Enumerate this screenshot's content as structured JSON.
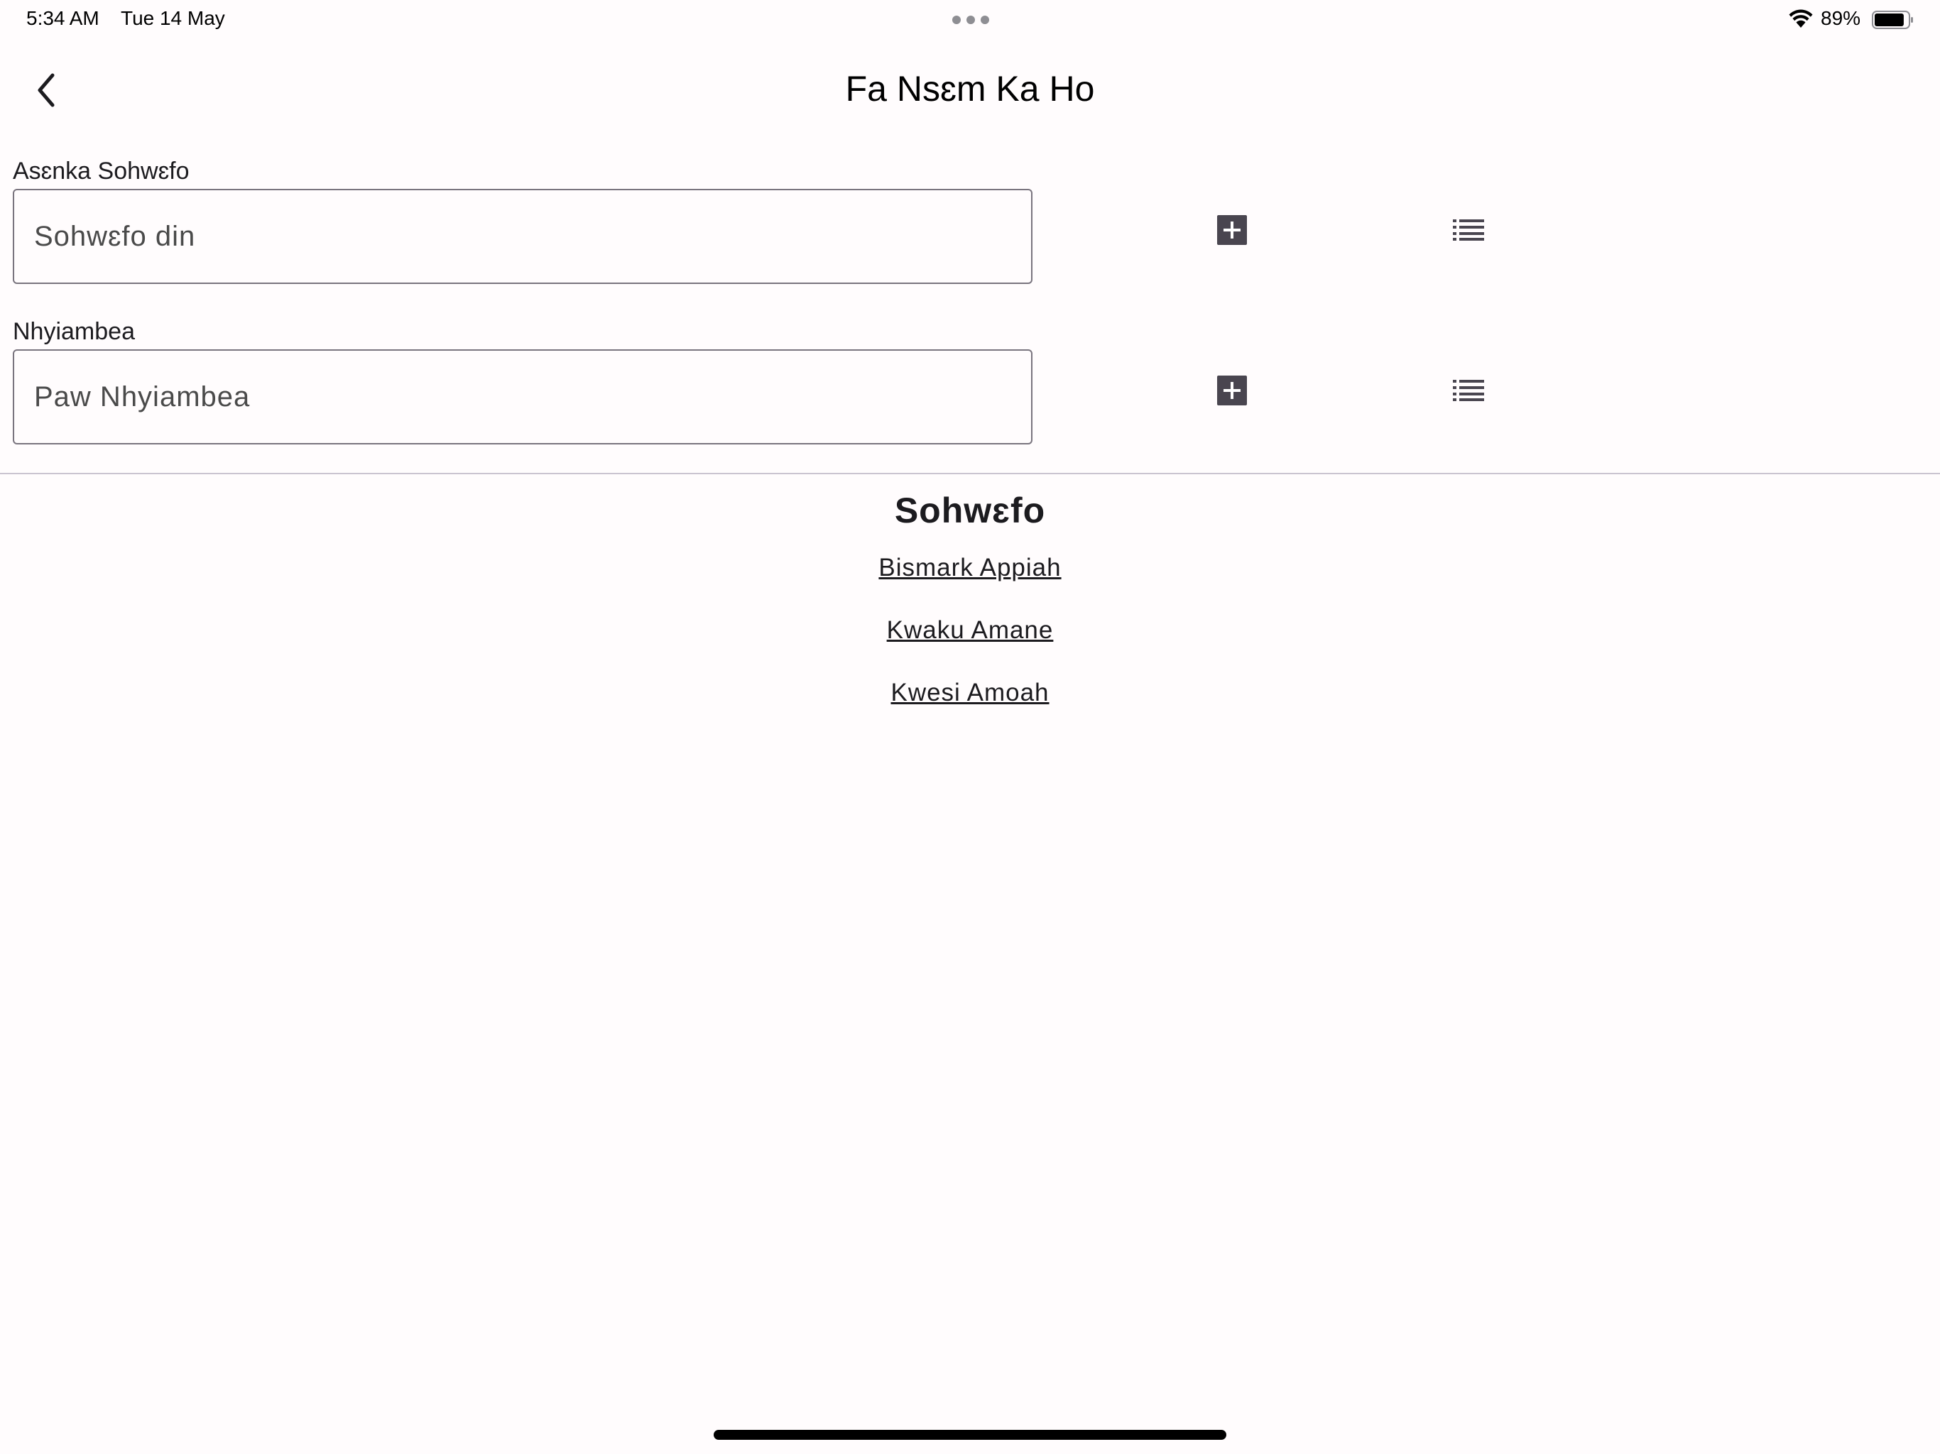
{
  "status_bar": {
    "time": "5:34 AM",
    "date": "Tue 14 May",
    "battery_percent": "89%",
    "battery_level": 0.89
  },
  "header": {
    "title": "Fa Nsɛm Ka Ho",
    "back_icon": "chevron-left-icon"
  },
  "form": {
    "fields": [
      {
        "label": "Asɛnka Sohwɛfo",
        "placeholder": "Sohwɛfo din",
        "value": "",
        "add_icon": "add-box-icon",
        "list_icon": "list-icon"
      },
      {
        "label": "Nhyiambea",
        "placeholder": "Paw Nhyiambea",
        "value": "",
        "add_icon": "add-box-icon",
        "list_icon": "list-icon"
      }
    ]
  },
  "people_section": {
    "title": "Sohwɛfo",
    "people": [
      "Bismark Appiah",
      "Kwaku Amane",
      "Kwesi Amoah"
    ]
  },
  "colors": {
    "background": "#fffcfd",
    "text": "#1c1b1f",
    "field_border": "#79747e",
    "icon": "#49454f",
    "divider": "#cac4d0"
  }
}
